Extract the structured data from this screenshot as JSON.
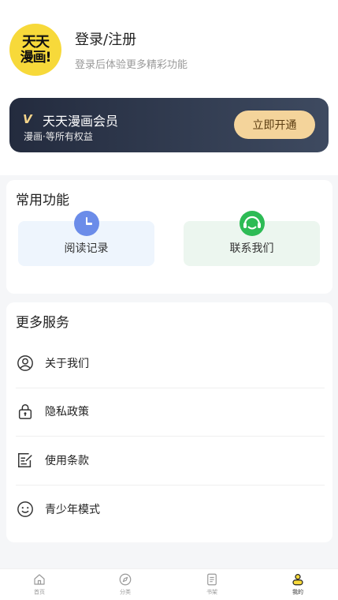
{
  "profile": {
    "logo_line1": "天天",
    "logo_line2": "漫画!",
    "login_title": "登录/注册",
    "login_subtitle": "登录后体验更多精彩功能"
  },
  "vip": {
    "badge": "V",
    "title": "天天漫画会员",
    "subtitle": "漫画·等所有权益",
    "button": "立即开通"
  },
  "common_functions": {
    "title": "常用功能",
    "items": [
      {
        "label": "阅读记录",
        "icon": "clock-icon"
      },
      {
        "label": "联系我们",
        "icon": "headset-icon"
      }
    ]
  },
  "more_services": {
    "title": "更多服务",
    "items": [
      {
        "label": "关于我们",
        "icon": "user-circle-icon"
      },
      {
        "label": "隐私政策",
        "icon": "lock-icon"
      },
      {
        "label": "使用条款",
        "icon": "edit-document-icon"
      },
      {
        "label": "青少年模式",
        "icon": "smile-icon"
      }
    ]
  },
  "tabbar": {
    "items": [
      {
        "label": "首页",
        "icon": "home-icon",
        "active": false
      },
      {
        "label": "分类",
        "icon": "compass-icon",
        "active": false
      },
      {
        "label": "书架",
        "icon": "document-icon",
        "active": false
      },
      {
        "label": "我的",
        "icon": "profile-icon",
        "active": true
      }
    ]
  },
  "colors": {
    "accent_yellow": "#f7d93a",
    "vip_button": "#f4d49b",
    "vip_card_dark": "#232b3e",
    "clock_blue": "#6b8ce9",
    "headset_green": "#2dbb55"
  }
}
